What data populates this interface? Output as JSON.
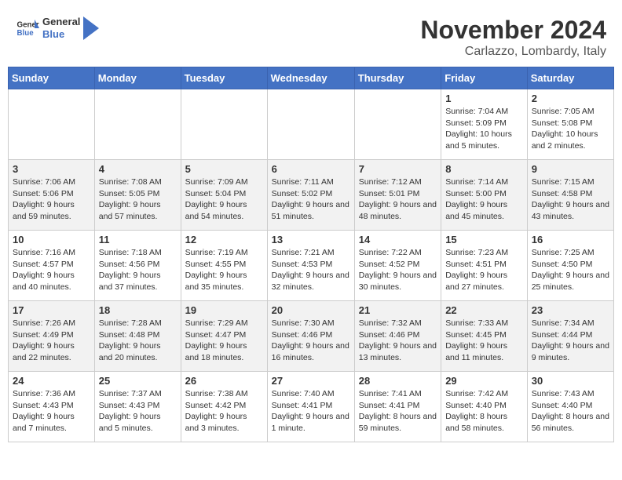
{
  "header": {
    "logo_text_general": "General",
    "logo_text_blue": "Blue",
    "month": "November 2024",
    "location": "Carlazzo, Lombardy, Italy"
  },
  "days_of_week": [
    "Sunday",
    "Monday",
    "Tuesday",
    "Wednesday",
    "Thursday",
    "Friday",
    "Saturday"
  ],
  "weeks": [
    [
      {
        "day": "",
        "info": ""
      },
      {
        "day": "",
        "info": ""
      },
      {
        "day": "",
        "info": ""
      },
      {
        "day": "",
        "info": ""
      },
      {
        "day": "",
        "info": ""
      },
      {
        "day": "1",
        "info": "Sunrise: 7:04 AM\nSunset: 5:09 PM\nDaylight: 10 hours and 5 minutes."
      },
      {
        "day": "2",
        "info": "Sunrise: 7:05 AM\nSunset: 5:08 PM\nDaylight: 10 hours and 2 minutes."
      }
    ],
    [
      {
        "day": "3",
        "info": "Sunrise: 7:06 AM\nSunset: 5:06 PM\nDaylight: 9 hours and 59 minutes."
      },
      {
        "day": "4",
        "info": "Sunrise: 7:08 AM\nSunset: 5:05 PM\nDaylight: 9 hours and 57 minutes."
      },
      {
        "day": "5",
        "info": "Sunrise: 7:09 AM\nSunset: 5:04 PM\nDaylight: 9 hours and 54 minutes."
      },
      {
        "day": "6",
        "info": "Sunrise: 7:11 AM\nSunset: 5:02 PM\nDaylight: 9 hours and 51 minutes."
      },
      {
        "day": "7",
        "info": "Sunrise: 7:12 AM\nSunset: 5:01 PM\nDaylight: 9 hours and 48 minutes."
      },
      {
        "day": "8",
        "info": "Sunrise: 7:14 AM\nSunset: 5:00 PM\nDaylight: 9 hours and 45 minutes."
      },
      {
        "day": "9",
        "info": "Sunrise: 7:15 AM\nSunset: 4:58 PM\nDaylight: 9 hours and 43 minutes."
      }
    ],
    [
      {
        "day": "10",
        "info": "Sunrise: 7:16 AM\nSunset: 4:57 PM\nDaylight: 9 hours and 40 minutes."
      },
      {
        "day": "11",
        "info": "Sunrise: 7:18 AM\nSunset: 4:56 PM\nDaylight: 9 hours and 37 minutes."
      },
      {
        "day": "12",
        "info": "Sunrise: 7:19 AM\nSunset: 4:55 PM\nDaylight: 9 hours and 35 minutes."
      },
      {
        "day": "13",
        "info": "Sunrise: 7:21 AM\nSunset: 4:53 PM\nDaylight: 9 hours and 32 minutes."
      },
      {
        "day": "14",
        "info": "Sunrise: 7:22 AM\nSunset: 4:52 PM\nDaylight: 9 hours and 30 minutes."
      },
      {
        "day": "15",
        "info": "Sunrise: 7:23 AM\nSunset: 4:51 PM\nDaylight: 9 hours and 27 minutes."
      },
      {
        "day": "16",
        "info": "Sunrise: 7:25 AM\nSunset: 4:50 PM\nDaylight: 9 hours and 25 minutes."
      }
    ],
    [
      {
        "day": "17",
        "info": "Sunrise: 7:26 AM\nSunset: 4:49 PM\nDaylight: 9 hours and 22 minutes."
      },
      {
        "day": "18",
        "info": "Sunrise: 7:28 AM\nSunset: 4:48 PM\nDaylight: 9 hours and 20 minutes."
      },
      {
        "day": "19",
        "info": "Sunrise: 7:29 AM\nSunset: 4:47 PM\nDaylight: 9 hours and 18 minutes."
      },
      {
        "day": "20",
        "info": "Sunrise: 7:30 AM\nSunset: 4:46 PM\nDaylight: 9 hours and 16 minutes."
      },
      {
        "day": "21",
        "info": "Sunrise: 7:32 AM\nSunset: 4:46 PM\nDaylight: 9 hours and 13 minutes."
      },
      {
        "day": "22",
        "info": "Sunrise: 7:33 AM\nSunset: 4:45 PM\nDaylight: 9 hours and 11 minutes."
      },
      {
        "day": "23",
        "info": "Sunrise: 7:34 AM\nSunset: 4:44 PM\nDaylight: 9 hours and 9 minutes."
      }
    ],
    [
      {
        "day": "24",
        "info": "Sunrise: 7:36 AM\nSunset: 4:43 PM\nDaylight: 9 hours and 7 minutes."
      },
      {
        "day": "25",
        "info": "Sunrise: 7:37 AM\nSunset: 4:43 PM\nDaylight: 9 hours and 5 minutes."
      },
      {
        "day": "26",
        "info": "Sunrise: 7:38 AM\nSunset: 4:42 PM\nDaylight: 9 hours and 3 minutes."
      },
      {
        "day": "27",
        "info": "Sunrise: 7:40 AM\nSunset: 4:41 PM\nDaylight: 9 hours and 1 minute."
      },
      {
        "day": "28",
        "info": "Sunrise: 7:41 AM\nSunset: 4:41 PM\nDaylight: 8 hours and 59 minutes."
      },
      {
        "day": "29",
        "info": "Sunrise: 7:42 AM\nSunset: 4:40 PM\nDaylight: 8 hours and 58 minutes."
      },
      {
        "day": "30",
        "info": "Sunrise: 7:43 AM\nSunset: 4:40 PM\nDaylight: 8 hours and 56 minutes."
      }
    ]
  ]
}
